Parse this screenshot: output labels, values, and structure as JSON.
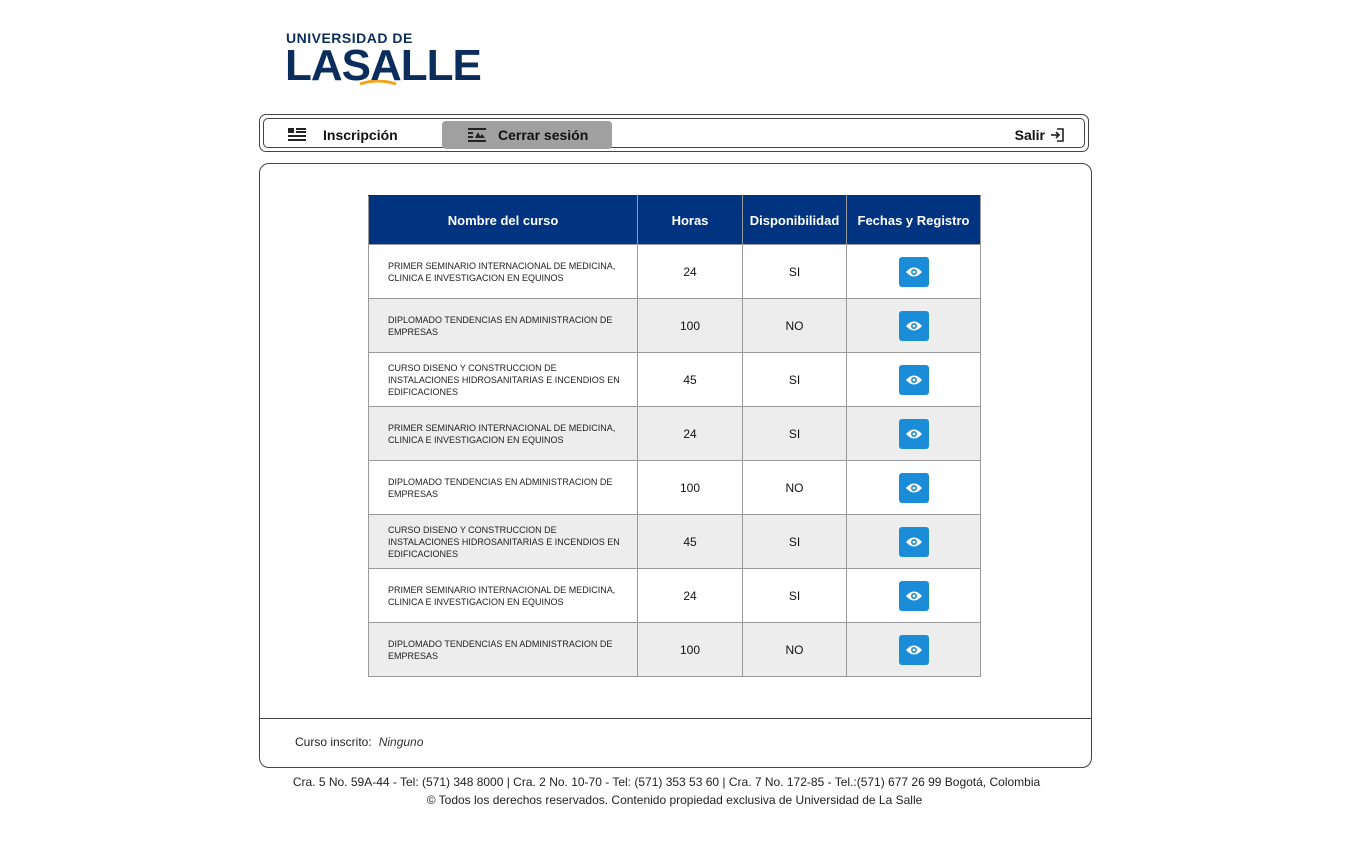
{
  "logo": {
    "top_text": "UNIVERSIDAD DE",
    "main_text": "LASALLE",
    "accent_color": "#f2a31d",
    "brand_color": "#0b2d5b"
  },
  "nav": {
    "inscripcion": {
      "label": "Inscripción",
      "icon": "list-icon"
    },
    "cerrar": {
      "label": "Cerrar sesión",
      "icon": "list-image-icon",
      "active": true
    },
    "salir": {
      "label": "Salir",
      "icon": "exit-icon"
    }
  },
  "table": {
    "headers": [
      "Nombre del curso",
      "Horas",
      "Disponibilidad",
      "Fechas y Registro"
    ],
    "header_color": "#003380",
    "button_color": "#1a8cd8",
    "rows": [
      {
        "name": "PRIMER SEMINARIO INTERNACIONAL DE MEDICINA, CLINICA E INVESTIGACION EN EQUINOS",
        "hours": "24",
        "availability": "SI",
        "action_icon": "eye-icon"
      },
      {
        "name": "DIPLOMADO TENDENCIAS EN ADMINISTRACION DE EMPRESAS",
        "hours": "100",
        "availability": "NO",
        "action_icon": "eye-icon"
      },
      {
        "name": "CURSO DISENO Y CONSTRUCCION DE INSTALACIONES HIDROSANITARIAS E INCENDIOS EN EDIFICACIONES",
        "hours": "45",
        "availability": "SI",
        "action_icon": "eye-icon"
      },
      {
        "name": "PRIMER SEMINARIO INTERNACIONAL DE MEDICINA, CLINICA E INVESTIGACION EN EQUINOS",
        "hours": "24",
        "availability": "SI",
        "action_icon": "eye-icon"
      },
      {
        "name": "DIPLOMADO TENDENCIAS EN ADMINISTRACION DE EMPRESAS",
        "hours": "100",
        "availability": "NO",
        "action_icon": "eye-icon"
      },
      {
        "name": "CURSO DISENO Y CONSTRUCCION DE INSTALACIONES HIDROSANITARIAS E INCENDIOS EN EDIFICACIONES",
        "hours": "45",
        "availability": "SI",
        "action_icon": "eye-icon"
      },
      {
        "name": "PRIMER SEMINARIO INTERNACIONAL DE MEDICINA, CLINICA E INVESTIGACION EN EQUINOS",
        "hours": "24",
        "availability": "SI",
        "action_icon": "eye-icon"
      },
      {
        "name": "DIPLOMADO TENDENCIAS EN ADMINISTRACION DE EMPRESAS",
        "hours": "100",
        "availability": "NO",
        "action_icon": "eye-icon"
      }
    ]
  },
  "enrolled": {
    "label": "Curso inscrito:",
    "value": "Ninguno"
  },
  "footer": {
    "line1": "Cra. 5 No. 59A-44 - Tel: (571) 348 8000 | Cra. 2 No. 10-70 - Tel: (571) 353 53 60 | Cra. 7 No. 172-85 - Tel.:(571) 677 26 99 Bogotá, Colombia",
    "line2": "© Todos los derechos reservados. Contenido propiedad exclusiva de Universidad de La Salle"
  }
}
